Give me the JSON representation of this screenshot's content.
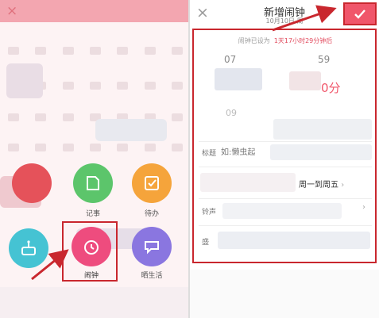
{
  "left_panel": {
    "apps": [
      {
        "label": "",
        "color": "#e5525a"
      },
      {
        "label": "记事",
        "color": "#5cc56b"
      },
      {
        "label": "待办",
        "color": "#f5a43b"
      },
      {
        "label": "",
        "color": "#45c3d3"
      },
      {
        "label": "闹钟",
        "color": "#ee4c7e"
      },
      {
        "label": "晒生活",
        "color": "#8a76e0"
      }
    ]
  },
  "right_panel": {
    "close_icon": "×",
    "title": "新增闹钟",
    "subtitle": "10月10日 周",
    "hint_prefix": "闹钟已设为",
    "hint_value": "1天17小时29分钟后",
    "picker": {
      "hour": "07",
      "minute": "59",
      "minute_unit": "0分",
      "hour_below": "09"
    },
    "title_label": "标题",
    "title_placeholder": "如:懒虫起",
    "repeat_value": "周一到周五",
    "ringtone_label": "铃声",
    "bottom_label": "盛"
  },
  "colors": {
    "accent": "#f0566a",
    "annotation_red": "#c9272e"
  }
}
